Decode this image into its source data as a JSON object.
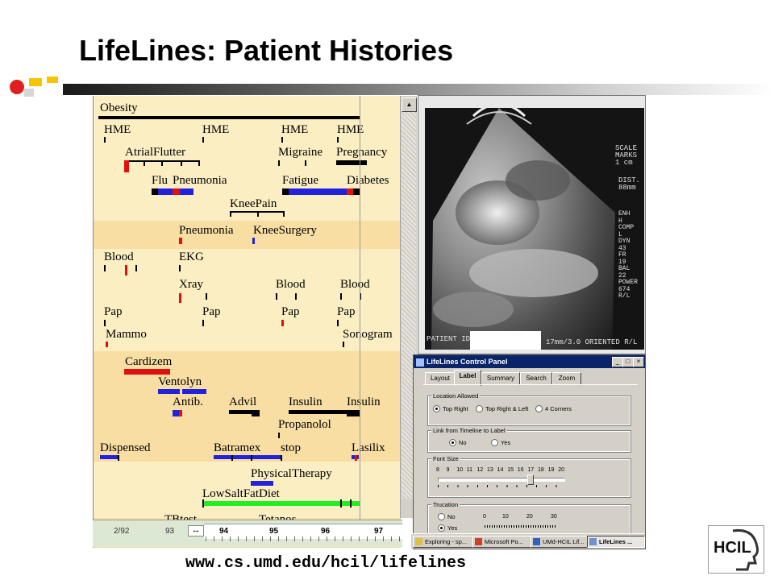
{
  "slide": {
    "title": "LifeLines: Patient Histories",
    "url": "www.cs.umd.edu/hcil/lifelines",
    "logo_text": "HCIL"
  },
  "timeline": {
    "labels": {
      "obesity": "Obesity",
      "hme1": "HME",
      "hme2": "HME",
      "hme3": "HME",
      "hme4": "HME",
      "atrial": "AtrialFlutter",
      "migraine": "Migraine",
      "pregnancy": "Pregnancy",
      "flu": "Flu",
      "pneumonia1": "Pneumonia",
      "fatigue": "Fatigue",
      "diabetes": "Diabetes",
      "kneepain": "KneePain",
      "pneumonia2": "Pneumonia",
      "kneesurgery": "KneeSurgery",
      "blood1": "Blood",
      "ekg": "EKG",
      "xray": "Xray",
      "blood2": "Blood",
      "blood3": "Blood",
      "pap1": "Pap",
      "pap2": "Pap",
      "pap3": "Pap",
      "pap4": "Pap",
      "mammo": "Mammo",
      "sonogram": "Sonogram",
      "cardizem": "Cardizem",
      "ventolyn": "Ventolyn",
      "antib": "Antib.",
      "advil": "Advil",
      "insulin1": "Insulin",
      "insulin2": "Insulin",
      "propanolol": "Propanolol",
      "dispensed": "Dispensed",
      "batramex": "Batramex",
      "stop": "stop",
      "lasilix": "Lasilix",
      "physical": "PhysicalTherapy",
      "lowsalt": "LowSaltFatDiet",
      "tbtest": "TBtest",
      "tetanos": "Tetanos"
    },
    "axis": {
      "start_small": "2/92",
      "small2": "93",
      "years": [
        "94",
        "95",
        "96",
        "97"
      ]
    },
    "colors": {
      "band_light": "#fbeec2",
      "band_dark": "#f8dea3",
      "red": "#e01010",
      "blue": "#2222dd",
      "green": "#22ee22",
      "black": "#000000"
    }
  },
  "image_overlay": {
    "scale": "SCALE\nMARKS\n1 cm",
    "dist": "DIST.\n88mm",
    "params": "ENH\nH\nCOMP\nL\nDYN\n43\nFR\n19\nBAL\n22\nPOWER\n674\nR/L",
    "patient": "PATIENT ID",
    "footer": "17mm/3.0  ORIENTED R/L"
  },
  "control_panel": {
    "title": "LifeLines Control Panel",
    "tabs": [
      "Layout",
      "Label",
      "Summary",
      "Search",
      "Zoom"
    ],
    "active_tab": "Label",
    "location_group": "Location Allowed",
    "location_options": [
      "Top Right",
      "Top Right & Left",
      "4 Corners"
    ],
    "link_group": "Link from Timeline to Label",
    "link_options": [
      "No",
      "Yes"
    ],
    "font_group": "Font Size",
    "font_sizes": [
      "8",
      "9",
      "10",
      "11",
      "12",
      "13",
      "14",
      "15",
      "16",
      "17",
      "18",
      "19",
      "20"
    ],
    "font_value": 17,
    "trunc_group": "Trucation",
    "trunc_options": [
      "No",
      "Yes"
    ],
    "trunc_scale": [
      "0",
      "10",
      "20",
      "30"
    ]
  },
  "taskbar": {
    "items": [
      "Exploring - sp...",
      "Microsoft Po...",
      "UMd-HCIL Lif...",
      "LifeLines ..."
    ]
  }
}
